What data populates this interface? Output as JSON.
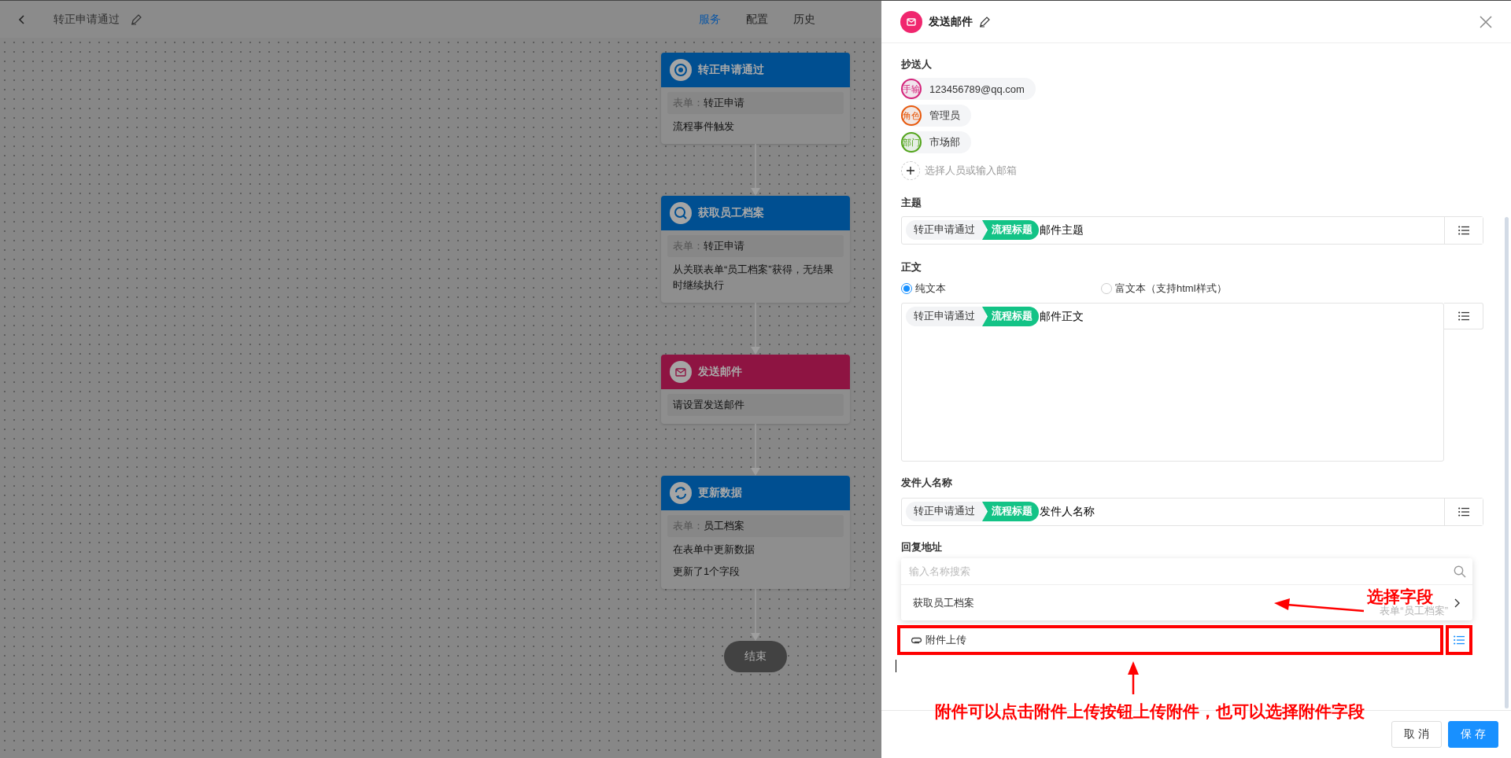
{
  "topbar": {
    "title": "转正申请通过",
    "tabs": [
      {
        "label": "服务",
        "selected": true
      },
      {
        "label": "配置",
        "selected": false
      },
      {
        "label": "历史",
        "selected": false
      }
    ]
  },
  "flow": {
    "nodes": [
      {
        "title": "转正申请通过",
        "kind": "trigger",
        "color": "#004f91",
        "rows": [
          {
            "kind": "field",
            "label": "表单：",
            "value": "转正申请"
          },
          {
            "kind": "text",
            "value": "流程事件触发"
          }
        ]
      },
      {
        "title": "获取员工档案",
        "kind": "search",
        "color": "#004f91",
        "rows": [
          {
            "kind": "field",
            "label": "表单：",
            "value": "转正申请"
          },
          {
            "kind": "text",
            "value": "从关联表单“员工档案”获得，无结果时继续执行"
          }
        ]
      },
      {
        "title": "发送邮件",
        "kind": "mail",
        "color": "#8e1442",
        "rows": [
          {
            "kind": "field",
            "value": "请设置发送邮件"
          }
        ]
      },
      {
        "title": "更新数据",
        "kind": "sync",
        "color": "#004f91",
        "rows": [
          {
            "kind": "field",
            "label": "表单：",
            "value": "员工档案"
          },
          {
            "kind": "text",
            "value": "在表单中更新数据"
          },
          {
            "kind": "text",
            "value": "更新了1个字段"
          }
        ]
      }
    ],
    "end": "结束"
  },
  "panel": {
    "title": "发送邮件",
    "cc": {
      "label": "抄送人",
      "recipients": [
        {
          "tag": "手输",
          "name": "123456789@qq.com",
          "color": "#d4237a"
        },
        {
          "tag": "角色",
          "name": "管理员",
          "color": "#e8590c"
        },
        {
          "tag": "部门",
          "name": "市场部",
          "color": "#52a41a"
        }
      ],
      "add_placeholder": "选择人员或输入邮箱"
    },
    "subject": {
      "label": "主题",
      "tokens": [
        {
          "kind": "node",
          "label": "转正申请通过"
        },
        {
          "kind": "field",
          "label": "流程标题"
        }
      ],
      "text": "邮件主题"
    },
    "body": {
      "label": "正文",
      "formats": [
        {
          "label": "纯文本",
          "selected": true
        },
        {
          "label": "富文本（支持html样式）",
          "selected": false
        }
      ],
      "tokens": [
        {
          "kind": "node",
          "label": "转正申请通过"
        },
        {
          "kind": "field",
          "label": "流程标题"
        }
      ],
      "text": "邮件正文"
    },
    "sender": {
      "label": "发件人名称",
      "tokens": [
        {
          "kind": "node",
          "label": "转正申请通过"
        },
        {
          "kind": "field",
          "label": "流程标题"
        }
      ],
      "text": "发件人名称"
    },
    "reply": {
      "label": "回复地址",
      "search_placeholder": "输入名称搜索",
      "options": [
        {
          "label": "获取员工档案",
          "hint": "表单“员工档案”"
        }
      ],
      "upload": "附件上传"
    },
    "buttons": [
      {
        "kind": "default",
        "label": "取消"
      },
      {
        "kind": "primary",
        "label": "保存"
      }
    ]
  },
  "annotations": [
    {
      "text": "选择字段"
    },
    {
      "text": "附件可以点击附件上传按钮上传附件，也可以选择附件字段"
    }
  ]
}
